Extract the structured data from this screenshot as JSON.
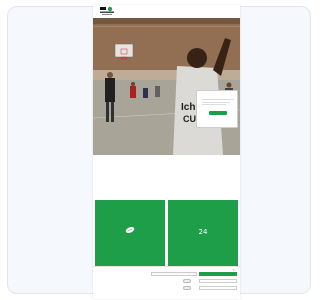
{
  "header": {
    "logo_text": "",
    "nav": [
      "",
      "",
      "",
      "",
      "",
      ""
    ]
  },
  "popup": {
    "title": "",
    "button": ""
  },
  "main": {
    "headline": "",
    "slogan": "",
    "subtitle": "",
    "note": ""
  },
  "cards": [
    {
      "icon": "football-icon",
      "glyph": "🏈",
      "label": ""
    },
    {
      "icon": "24-7-icon",
      "glyph": "24",
      "label": ""
    }
  ],
  "cookie": {
    "close": "×",
    "text": "",
    "accept": "",
    "rows": [
      {
        "label": ""
      },
      {
        "label": ""
      }
    ]
  },
  "footer": {
    "left": "",
    "right": ""
  },
  "colors": {
    "accent": "#1f9e4a",
    "hero_wall": "#8a6a52"
  }
}
